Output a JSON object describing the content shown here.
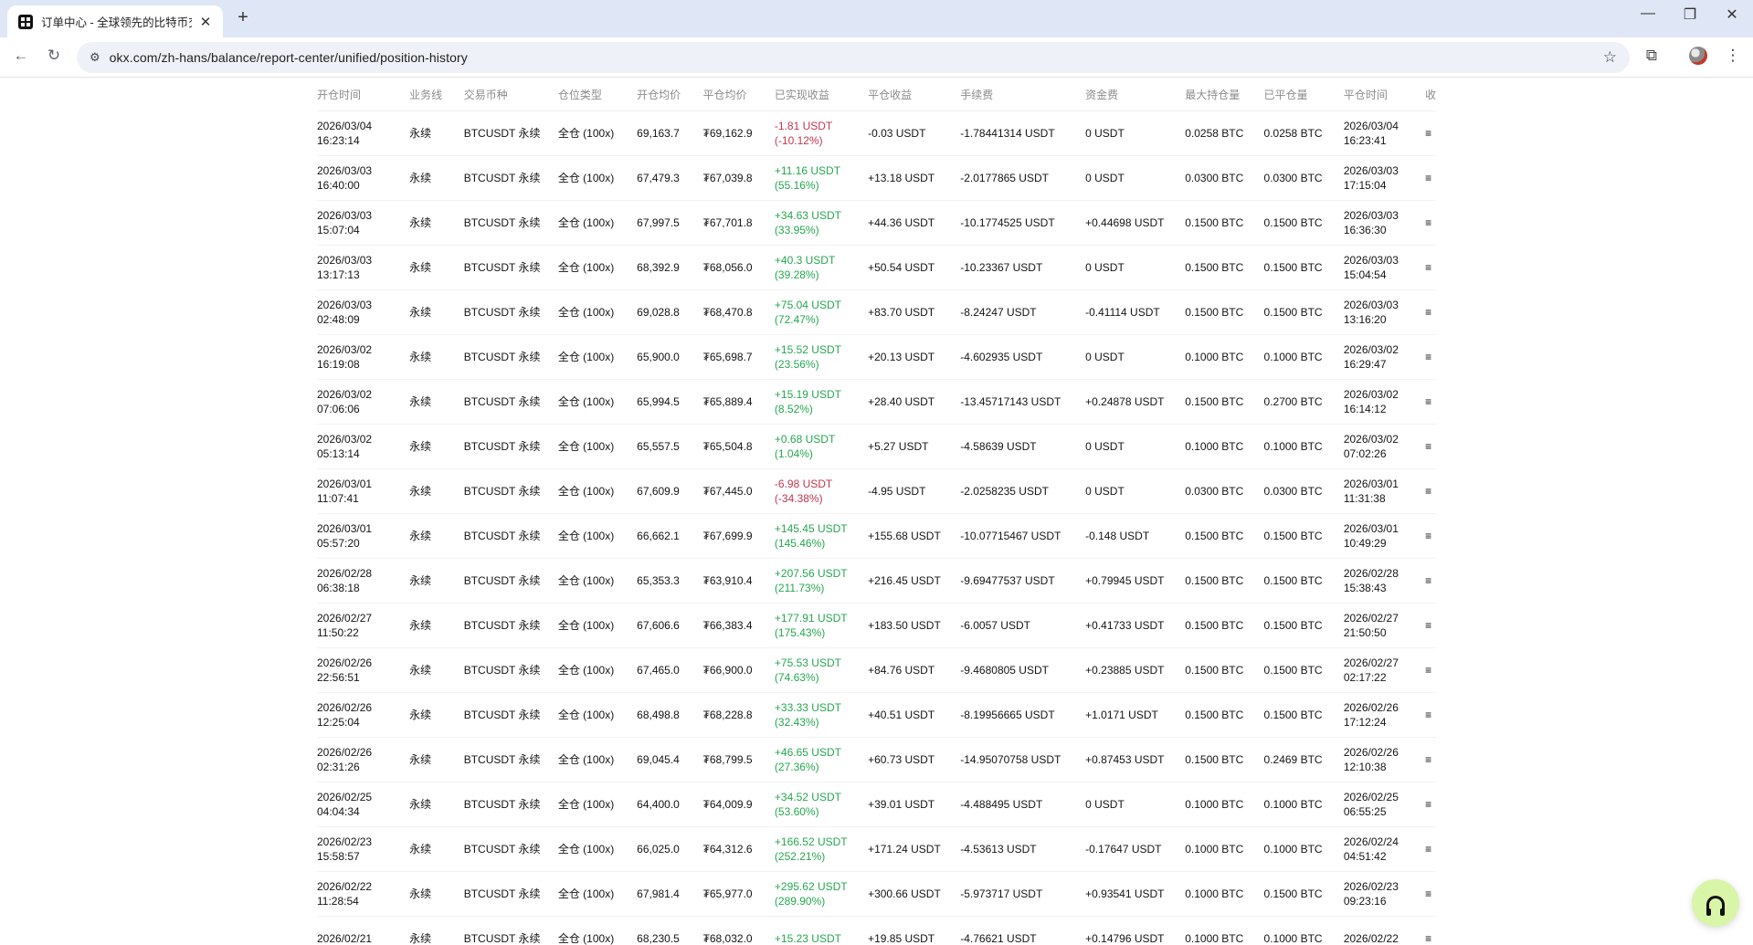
{
  "browser": {
    "tab_title": "订单中心 - 全球领先的比特币交易平台",
    "tab_close": "✕",
    "new_tab": "+",
    "url": "okx.com/zh-hans/balance/report-center/unified/position-history",
    "back_glyph": "←",
    "reload_glyph": "↻",
    "star_glyph": "☆",
    "extensions_glyph": "⧉",
    "menu_glyph": "⋮",
    "site_info_glyph": "⚙",
    "minimize_glyph": "—",
    "restore_glyph": "❐",
    "close_glyph": "✕"
  },
  "table": {
    "headers": [
      "开仓时间",
      "业务线",
      "交易币种",
      "仓位类型",
      "开仓均价",
      "平仓均价",
      "已实现收益",
      "平仓收益",
      "手续费",
      "资金费",
      "最大持仓量",
      "已平仓量",
      "平仓时间",
      "收"
    ],
    "rows": [
      {
        "open_date": "2026/03/04",
        "open_time": "16:23:14",
        "biz": "永续",
        "pair": "BTCUSDT 永续",
        "margin": "全仓 (100x)",
        "open_avg": "69,163.7",
        "close_avg": "₮69,162.9",
        "pnl": "-1.81 USDT",
        "pnl_pct": "(-10.12%)",
        "pnl_sign": "neg",
        "close_pnl": "-0.03 USDT",
        "fee": "-1.78441314 USDT",
        "funding": "0 USDT",
        "max_pos": "0.0258 BTC",
        "closed": "0.0258 BTC",
        "close_date": "2026/03/04",
        "close_time": "16:23:41",
        "more": "≡"
      },
      {
        "open_date": "2026/03/03",
        "open_time": "16:40:00",
        "biz": "永续",
        "pair": "BTCUSDT 永续",
        "margin": "全仓 (100x)",
        "open_avg": "67,479.3",
        "close_avg": "₮67,039.8",
        "pnl": "+11.16 USDT",
        "pnl_pct": "(55.16%)",
        "pnl_sign": "pos",
        "close_pnl": "+13.18 USDT",
        "fee": "-2.0177865 USDT",
        "funding": "0 USDT",
        "max_pos": "0.0300 BTC",
        "closed": "0.0300 BTC",
        "close_date": "2026/03/03",
        "close_time": "17:15:04",
        "more": "≡"
      },
      {
        "open_date": "2026/03/03",
        "open_time": "15:07:04",
        "biz": "永续",
        "pair": "BTCUSDT 永续",
        "margin": "全仓 (100x)",
        "open_avg": "67,997.5",
        "close_avg": "₮67,701.8",
        "pnl": "+34.63 USDT",
        "pnl_pct": "(33.95%)",
        "pnl_sign": "pos",
        "close_pnl": "+44.36 USDT",
        "fee": "-10.1774525 USDT",
        "funding": "+0.44698 USDT",
        "max_pos": "0.1500 BTC",
        "closed": "0.1500 BTC",
        "close_date": "2026/03/03",
        "close_time": "16:36:30",
        "more": "≡"
      },
      {
        "open_date": "2026/03/03",
        "open_time": "13:17:13",
        "biz": "永续",
        "pair": "BTCUSDT 永续",
        "margin": "全仓 (100x)",
        "open_avg": "68,392.9",
        "close_avg": "₮68,056.0",
        "pnl": "+40.3 USDT",
        "pnl_pct": "(39.28%)",
        "pnl_sign": "pos",
        "close_pnl": "+50.54 USDT",
        "fee": "-10.23367 USDT",
        "funding": "0 USDT",
        "max_pos": "0.1500 BTC",
        "closed": "0.1500 BTC",
        "close_date": "2026/03/03",
        "close_time": "15:04:54",
        "more": "≡"
      },
      {
        "open_date": "2026/03/03",
        "open_time": "02:48:09",
        "biz": "永续",
        "pair": "BTCUSDT 永续",
        "margin": "全仓 (100x)",
        "open_avg": "69,028.8",
        "close_avg": "₮68,470.8",
        "pnl": "+75.04 USDT",
        "pnl_pct": "(72.47%)",
        "pnl_sign": "pos",
        "close_pnl": "+83.70 USDT",
        "fee": "-8.24247 USDT",
        "funding": "-0.41114 USDT",
        "max_pos": "0.1500 BTC",
        "closed": "0.1500 BTC",
        "close_date": "2026/03/03",
        "close_time": "13:16:20",
        "more": "≡"
      },
      {
        "open_date": "2026/03/02",
        "open_time": "16:19:08",
        "biz": "永续",
        "pair": "BTCUSDT 永续",
        "margin": "全仓 (100x)",
        "open_avg": "65,900.0",
        "close_avg": "₮65,698.7",
        "pnl": "+15.52 USDT",
        "pnl_pct": "(23.56%)",
        "pnl_sign": "pos",
        "close_pnl": "+20.13 USDT",
        "fee": "-4.602935 USDT",
        "funding": "0 USDT",
        "max_pos": "0.1000 BTC",
        "closed": "0.1000 BTC",
        "close_date": "2026/03/02",
        "close_time": "16:29:47",
        "more": "≡"
      },
      {
        "open_date": "2026/03/02",
        "open_time": "07:06:06",
        "biz": "永续",
        "pair": "BTCUSDT 永续",
        "margin": "全仓 (100x)",
        "open_avg": "65,994.5",
        "close_avg": "₮65,889.4",
        "pnl": "+15.19 USDT",
        "pnl_pct": "(8.52%)",
        "pnl_sign": "pos",
        "close_pnl": "+28.40 USDT",
        "fee": "-13.45717143 USDT",
        "funding": "+0.24878 USDT",
        "max_pos": "0.1500 BTC",
        "closed": "0.2700 BTC",
        "close_date": "2026/03/02",
        "close_time": "16:14:12",
        "more": "≡"
      },
      {
        "open_date": "2026/03/02",
        "open_time": "05:13:14",
        "biz": "永续",
        "pair": "BTCUSDT 永续",
        "margin": "全仓 (100x)",
        "open_avg": "65,557.5",
        "close_avg": "₮65,504.8",
        "pnl": "+0.68 USDT",
        "pnl_pct": "(1.04%)",
        "pnl_sign": "pos",
        "close_pnl": "+5.27 USDT",
        "fee": "-4.58639 USDT",
        "funding": "0 USDT",
        "max_pos": "0.1000 BTC",
        "closed": "0.1000 BTC",
        "close_date": "2026/03/02",
        "close_time": "07:02:26",
        "more": "≡"
      },
      {
        "open_date": "2026/03/01",
        "open_time": "11:07:41",
        "biz": "永续",
        "pair": "BTCUSDT 永续",
        "margin": "全仓 (100x)",
        "open_avg": "67,609.9",
        "close_avg": "₮67,445.0",
        "pnl": "-6.98 USDT",
        "pnl_pct": "(-34.38%)",
        "pnl_sign": "neg",
        "close_pnl": "-4.95 USDT",
        "fee": "-2.0258235 USDT",
        "funding": "0 USDT",
        "max_pos": "0.0300 BTC",
        "closed": "0.0300 BTC",
        "close_date": "2026/03/01",
        "close_time": "11:31:38",
        "more": "≡"
      },
      {
        "open_date": "2026/03/01",
        "open_time": "05:57:20",
        "biz": "永续",
        "pair": "BTCUSDT 永续",
        "margin": "全仓 (100x)",
        "open_avg": "66,662.1",
        "close_avg": "₮67,699.9",
        "pnl": "+145.45 USDT",
        "pnl_pct": "(145.46%)",
        "pnl_sign": "pos",
        "close_pnl": "+155.68 USDT",
        "fee": "-10.07715467 USDT",
        "funding": "-0.148 USDT",
        "max_pos": "0.1500 BTC",
        "closed": "0.1500 BTC",
        "close_date": "2026/03/01",
        "close_time": "10:49:29",
        "more": "≡"
      },
      {
        "open_date": "2026/02/28",
        "open_time": "06:38:18",
        "biz": "永续",
        "pair": "BTCUSDT 永续",
        "margin": "全仓 (100x)",
        "open_avg": "65,353.3",
        "close_avg": "₮63,910.4",
        "pnl": "+207.56 USDT",
        "pnl_pct": "(211.73%)",
        "pnl_sign": "pos",
        "close_pnl": "+216.45 USDT",
        "fee": "-9.69477537 USDT",
        "funding": "+0.79945 USDT",
        "max_pos": "0.1500 BTC",
        "closed": "0.1500 BTC",
        "close_date": "2026/02/28",
        "close_time": "15:38:43",
        "more": "≡"
      },
      {
        "open_date": "2026/02/27",
        "open_time": "11:50:22",
        "biz": "永续",
        "pair": "BTCUSDT 永续",
        "margin": "全仓 (100x)",
        "open_avg": "67,606.6",
        "close_avg": "₮66,383.4",
        "pnl": "+177.91 USDT",
        "pnl_pct": "(175.43%)",
        "pnl_sign": "pos",
        "close_pnl": "+183.50 USDT",
        "fee": "-6.0057 USDT",
        "funding": "+0.41733 USDT",
        "max_pos": "0.1500 BTC",
        "closed": "0.1500 BTC",
        "close_date": "2026/02/27",
        "close_time": "21:50:50",
        "more": "≡"
      },
      {
        "open_date": "2026/02/26",
        "open_time": "22:56:51",
        "biz": "永续",
        "pair": "BTCUSDT 永续",
        "margin": "全仓 (100x)",
        "open_avg": "67,465.0",
        "close_avg": "₮66,900.0",
        "pnl": "+75.53 USDT",
        "pnl_pct": "(74.63%)",
        "pnl_sign": "pos",
        "close_pnl": "+84.76 USDT",
        "fee": "-9.4680805 USDT",
        "funding": "+0.23885 USDT",
        "max_pos": "0.1500 BTC",
        "closed": "0.1500 BTC",
        "close_date": "2026/02/27",
        "close_time": "02:17:22",
        "more": "≡"
      },
      {
        "open_date": "2026/02/26",
        "open_time": "12:25:04",
        "biz": "永续",
        "pair": "BTCUSDT 永续",
        "margin": "全仓 (100x)",
        "open_avg": "68,498.8",
        "close_avg": "₮68,228.8",
        "pnl": "+33.33 USDT",
        "pnl_pct": "(32.43%)",
        "pnl_sign": "pos",
        "close_pnl": "+40.51 USDT",
        "fee": "-8.19956665 USDT",
        "funding": "+1.0171 USDT",
        "max_pos": "0.1500 BTC",
        "closed": "0.1500 BTC",
        "close_date": "2026/02/26",
        "close_time": "17:12:24",
        "more": "≡"
      },
      {
        "open_date": "2026/02/26",
        "open_time": "02:31:26",
        "biz": "永续",
        "pair": "BTCUSDT 永续",
        "margin": "全仓 (100x)",
        "open_avg": "69,045.4",
        "close_avg": "₮68,799.5",
        "pnl": "+46.65 USDT",
        "pnl_pct": "(27.36%)",
        "pnl_sign": "pos",
        "close_pnl": "+60.73 USDT",
        "fee": "-14.95070758 USDT",
        "funding": "+0.87453 USDT",
        "max_pos": "0.1500 BTC",
        "closed": "0.2469 BTC",
        "close_date": "2026/02/26",
        "close_time": "12:10:38",
        "more": "≡"
      },
      {
        "open_date": "2026/02/25",
        "open_time": "04:04:34",
        "biz": "永续",
        "pair": "BTCUSDT 永续",
        "margin": "全仓 (100x)",
        "open_avg": "64,400.0",
        "close_avg": "₮64,009.9",
        "pnl": "+34.52 USDT",
        "pnl_pct": "(53.60%)",
        "pnl_sign": "pos",
        "close_pnl": "+39.01 USDT",
        "fee": "-4.488495 USDT",
        "funding": "0 USDT",
        "max_pos": "0.1000 BTC",
        "closed": "0.1000 BTC",
        "close_date": "2026/02/25",
        "close_time": "06:55:25",
        "more": "≡"
      },
      {
        "open_date": "2026/02/23",
        "open_time": "15:58:57",
        "biz": "永续",
        "pair": "BTCUSDT 永续",
        "margin": "全仓 (100x)",
        "open_avg": "66,025.0",
        "close_avg": "₮64,312.6",
        "pnl": "+166.52 USDT",
        "pnl_pct": "(252.21%)",
        "pnl_sign": "pos",
        "close_pnl": "+171.24 USDT",
        "fee": "-4.53613 USDT",
        "funding": "-0.17647 USDT",
        "max_pos": "0.1000 BTC",
        "closed": "0.1000 BTC",
        "close_date": "2026/02/24",
        "close_time": "04:51:42",
        "more": "≡"
      },
      {
        "open_date": "2026/02/22",
        "open_time": "11:28:54",
        "biz": "永续",
        "pair": "BTCUSDT 永续",
        "margin": "全仓 (100x)",
        "open_avg": "67,981.4",
        "close_avg": "₮65,977.0",
        "pnl": "+295.62 USDT",
        "pnl_pct": "(289.90%)",
        "pnl_sign": "pos",
        "close_pnl": "+300.66 USDT",
        "fee": "-5.973717 USDT",
        "funding": "+0.93541 USDT",
        "max_pos": "0.1000 BTC",
        "closed": "0.1500 BTC",
        "close_date": "2026/02/23",
        "close_time": "09:23:16",
        "more": "≡"
      },
      {
        "open_date": "2026/02/21",
        "open_time": "",
        "biz": "永续",
        "pair": "BTCUSDT 永续",
        "margin": "全仓 (100x)",
        "open_avg": "68,230.5",
        "close_avg": "₮68,032.0",
        "pnl": "+15.23 USDT",
        "pnl_pct": "",
        "pnl_sign": "pos",
        "close_pnl": "+19.85 USDT",
        "fee": "-4.76621 USDT",
        "funding": "+0.14796 USDT",
        "max_pos": "0.1000 BTC",
        "closed": "0.1000 BTC",
        "close_date": "2026/02/22",
        "close_time": "",
        "more": "≡"
      }
    ]
  },
  "colors": {
    "positive": "#25a750",
    "negative": "#c4364e",
    "support_button": "#d9f5a8"
  },
  "support_icon": "headset-icon"
}
